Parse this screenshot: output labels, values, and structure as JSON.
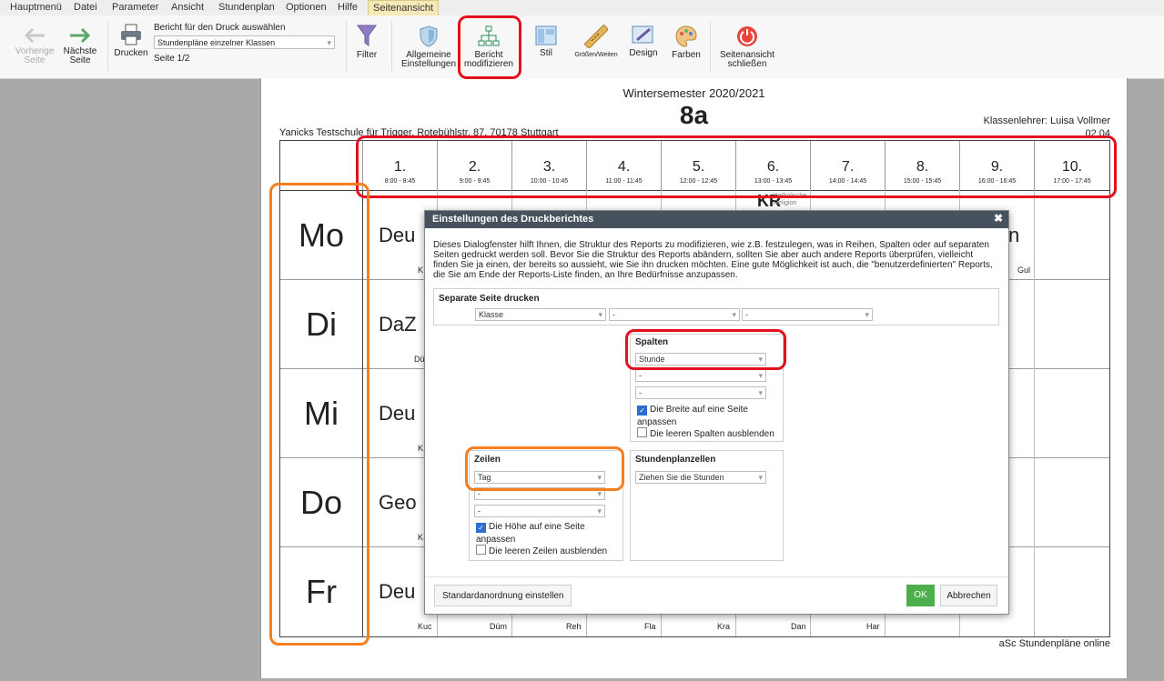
{
  "menu": [
    "Hauptmenü",
    "Datei",
    "Parameter",
    "Ansicht",
    "Stundenplan",
    "Optionen",
    "Hilfe"
  ],
  "menu_active": "Seitenansicht",
  "toolbar": {
    "prev": "Vorherige Seite",
    "next": "Nächste Seite",
    "print": "Drucken",
    "report_label": "Bericht für den Druck auswählen",
    "report_value": "Stundenpläne einzelner Klassen",
    "page": "Seite 1/2",
    "filter": "Filter",
    "general": "Allgemeine Einstellungen",
    "modify": "Bericht modifizieren",
    "style": "Stil",
    "sizes": "Größen/Weiten",
    "design": "Design",
    "colors": "Farben",
    "close": "Seitenansicht schließen"
  },
  "sheet": {
    "semester": "Wintersemester 2020/2021",
    "class": "8a",
    "school": "Yanicks Testschule für Trigger, Rotebühlstr. 87, 70178 Stuttgart",
    "teacher": "Klassenlehrer: Luisa Vollmer",
    "room": "02.04",
    "footer": "aSc Stundenpläne online",
    "periods": [
      {
        "n": "1.",
        "t": "8:00 - 8:45"
      },
      {
        "n": "2.",
        "t": "9:00 - 9:45"
      },
      {
        "n": "3.",
        "t": "10:00 - 10:45"
      },
      {
        "n": "4.",
        "t": "11:00 - 11:45"
      },
      {
        "n": "5.",
        "t": "12:00 - 12:45"
      },
      {
        "n": "6.",
        "t": "13:00 - 13:45"
      },
      {
        "n": "7.",
        "t": "14:00 - 14:45"
      },
      {
        "n": "8.",
        "t": "15:00 - 15:45"
      },
      {
        "n": "9.",
        "t": "16:00 - 16:45"
      },
      {
        "n": "10.",
        "t": "17:00 - 17:45"
      }
    ],
    "days": [
      "Mo",
      "Di",
      "Mi",
      "Do",
      "Fr"
    ],
    "day_cells": [
      {
        "s": "Deu",
        "t": "K"
      },
      {
        "s": "DaZ",
        "t": "Dü"
      },
      {
        "s": "Deu",
        "t": "K"
      },
      {
        "s": "Geo",
        "t": "K"
      },
      {
        "s": "Deu",
        "t": "Kuc"
      }
    ],
    "kr": "KR",
    "kr_small": "Katholische Religion",
    "mo_right": "n",
    "mo_right_t": "Gul",
    "fr_teachers": [
      "Düm",
      "Reh",
      "Fla",
      "Kra",
      "Dan",
      "Har"
    ]
  },
  "dialog": {
    "title": "Einstellungen des Druckberichtes",
    "close": "✖",
    "description": "Dieses Dialogfenster hilft Ihnen, die Struktur des Reports zu modifizieren, wie z.B. festzulegen, was in Reihen, Spalten oder auf separaten Seiten gedruckt werden soll. Bevor Sie die Struktur des Reports abändern, sollten Sie aber auch andere Reports überprüfen, vielleicht finden Sie ja einen, der bereits so aussieht, wie Sie ihn drucken möchten. Eine gute Möglichkeit ist auch, die \"benutzerdefinierten\" Reports, die Sie am Ende der Reports-Liste finden, an Ihre Bedürfnisse anzupassen.",
    "separate_title": "Separate Seite drucken",
    "separate_values": [
      "Klasse",
      "-",
      "-"
    ],
    "columns_title": "Spalten",
    "columns_values": [
      "Stunde",
      "-",
      "-"
    ],
    "columns_fit": "Die Breite auf eine Seite anpassen",
    "columns_hide": "Die leeren Spalten ausblenden",
    "rows_title": "Zeilen",
    "rows_values": [
      "Tag",
      "-",
      "-"
    ],
    "rows_fit": "Die Höhe auf eine Seite anpassen",
    "rows_hide": "Die leeren Zeilen ausblenden",
    "cells_title": "Stundenplanzellen",
    "cells_value": "Ziehen Sie die Stunden",
    "btn_default": "Standardanordnung einstellen",
    "btn_ok": "OK",
    "btn_cancel": "Abbrechen"
  }
}
